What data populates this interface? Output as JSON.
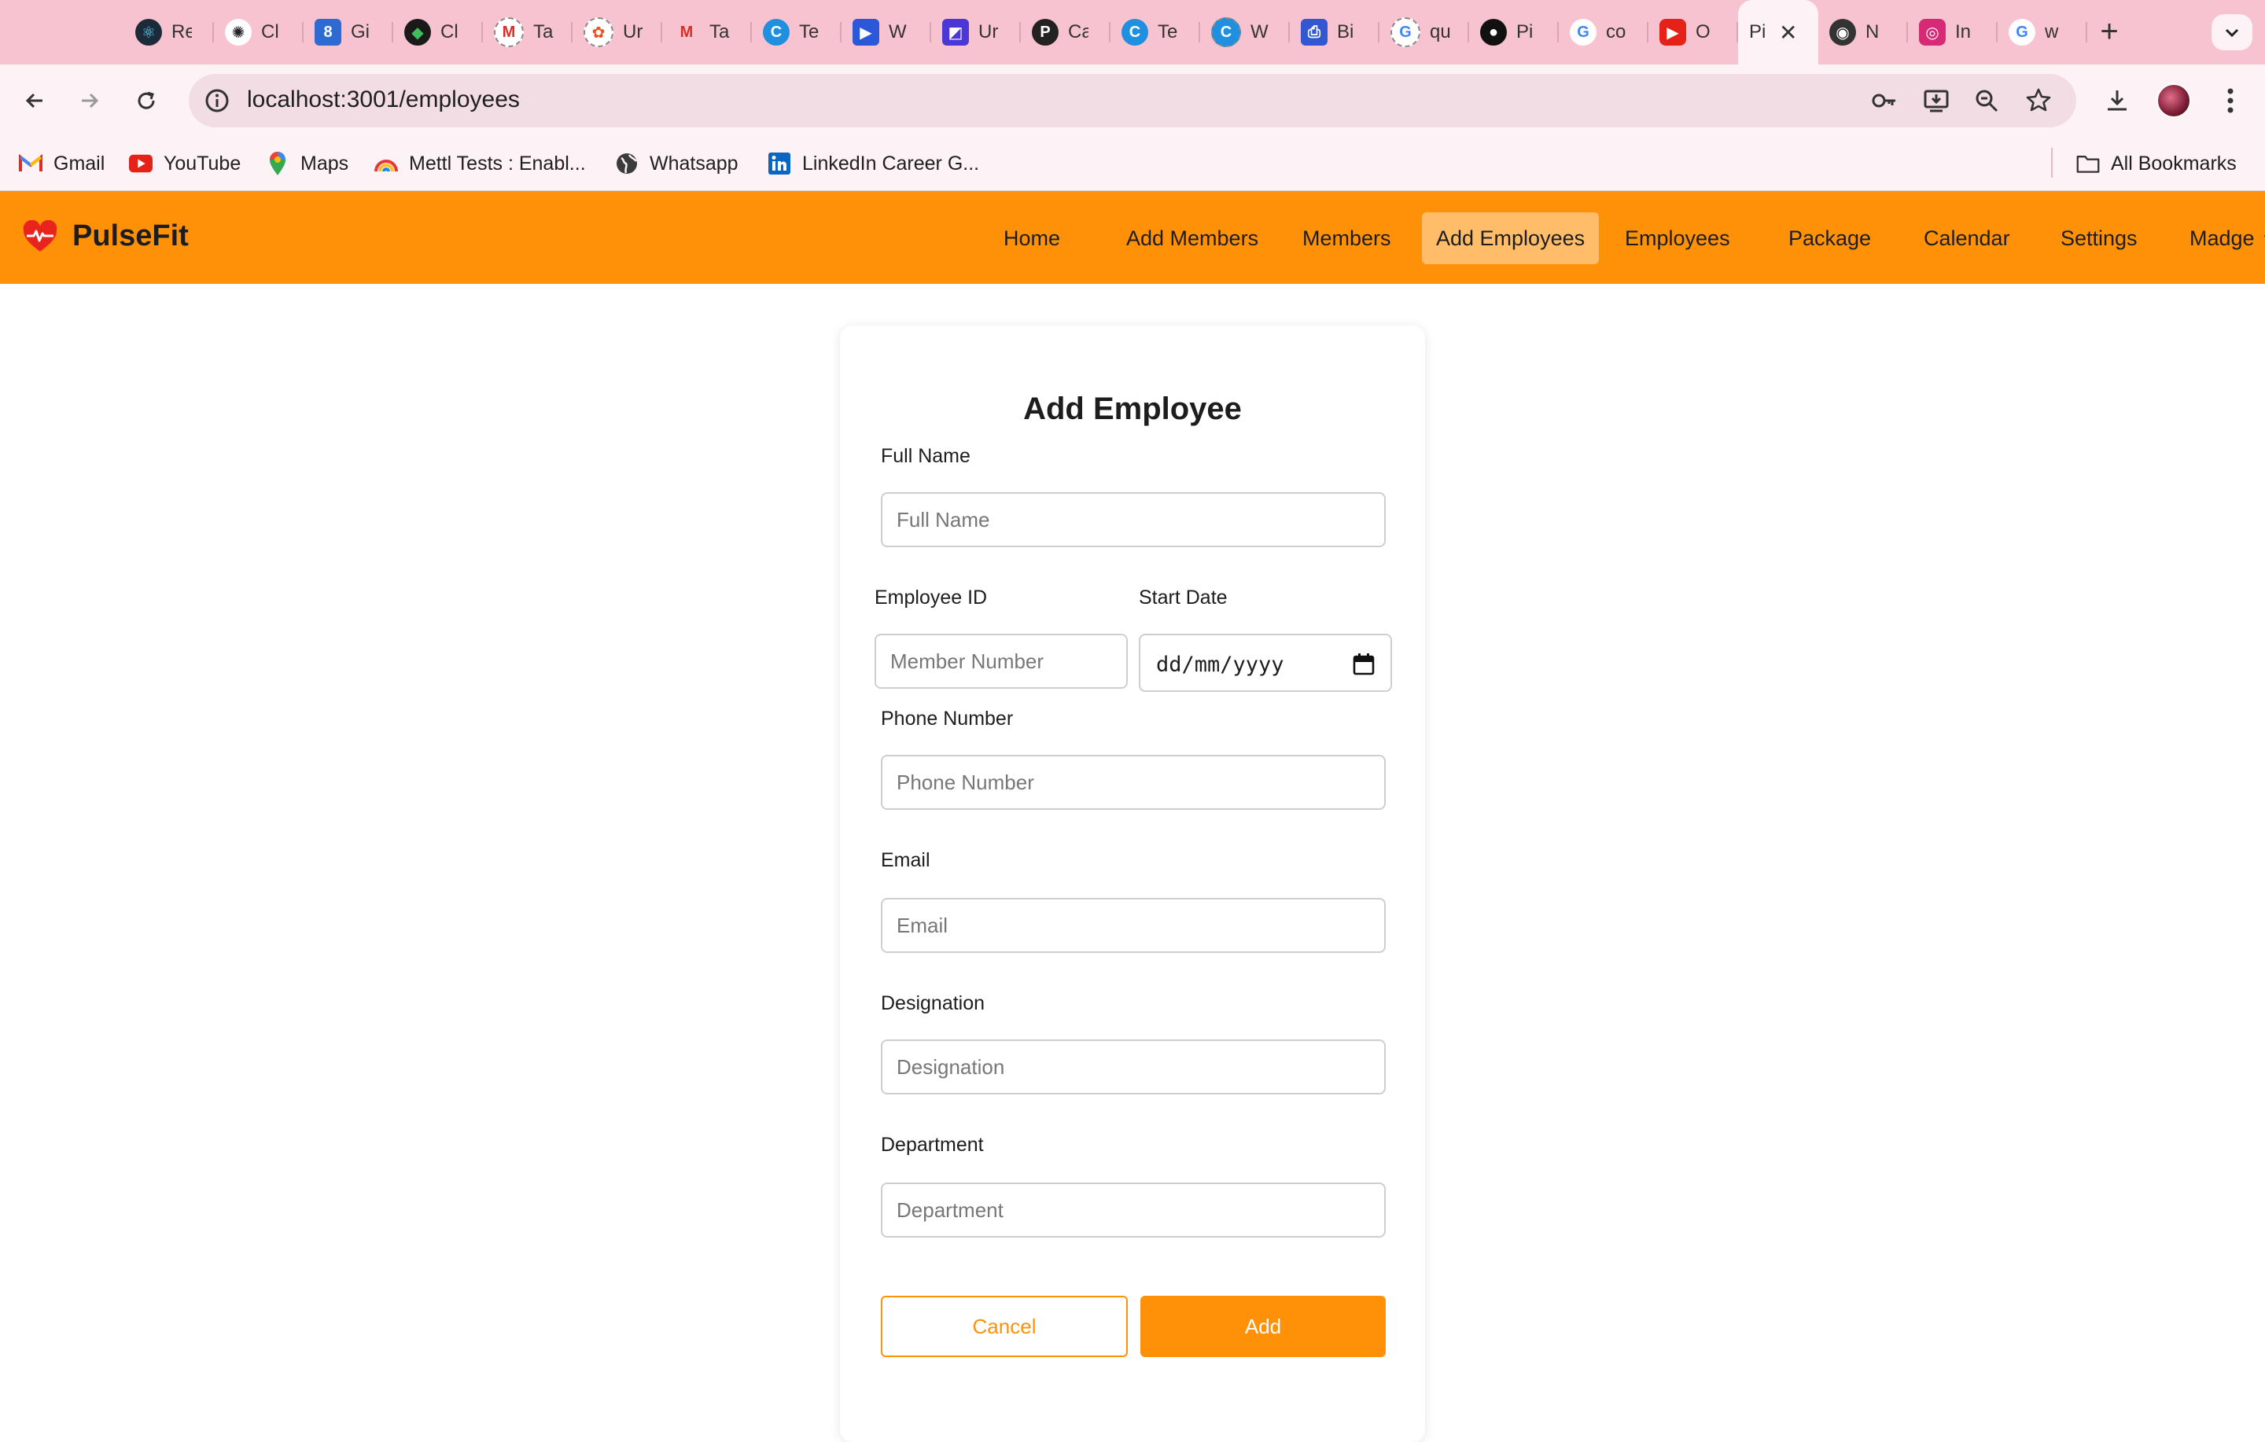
{
  "browser": {
    "tabs": [
      {
        "label": "Re",
        "icon": "react-icon",
        "color": "#1b2b3a"
      },
      {
        "label": "Cl",
        "icon": "chatgpt-icon",
        "color": "#ffffff"
      },
      {
        "label": "Gi",
        "icon": "calendar-icon",
        "color": "#2d6bd3"
      },
      {
        "label": "Cl",
        "icon": "mongodb-leaf-icon",
        "color": "#1a1a1a"
      },
      {
        "label": "Ta",
        "icon": "gmail-icon",
        "color": "#ffffff"
      },
      {
        "label": "Ur",
        "icon": "figma-icon",
        "color": "#ffffff"
      },
      {
        "label": "Ta",
        "icon": "gmail-icon",
        "color": "#ffffff"
      },
      {
        "label": "Te",
        "icon": "canva-icon",
        "color": "#1f8fe0"
      },
      {
        "label": "W",
        "icon": "video-icon",
        "color": "#2b58d9"
      },
      {
        "label": "Ur",
        "icon": "app-icon",
        "color": "#4a37d6"
      },
      {
        "label": "Ca",
        "icon": "chrome-profile-icon",
        "color": "#222222"
      },
      {
        "label": "Te",
        "icon": "canva-icon",
        "color": "#1f8fe0"
      },
      {
        "label": "W",
        "icon": "canva-icon",
        "color": "#1f8fe0"
      },
      {
        "label": "Bi",
        "icon": "printer-icon",
        "color": "#3357d1"
      },
      {
        "label": "qu",
        "icon": "google-icon",
        "color": "#ffffff"
      },
      {
        "label": "Pi",
        "icon": "github-icon",
        "color": "#111111"
      },
      {
        "label": "co",
        "icon": "google-icon",
        "color": "#ffffff"
      },
      {
        "label": "O",
        "icon": "youtube-icon",
        "color": "#e62117"
      },
      {
        "label": "Pi",
        "icon": "",
        "color": "#fdf2f5",
        "active": true
      },
      {
        "label": "N",
        "icon": "chrome-icon",
        "color": "#333333"
      },
      {
        "label": "In",
        "icon": "instagram-icon",
        "color": "#d62976"
      },
      {
        "label": "w",
        "icon": "google-icon",
        "color": "#ffffff"
      }
    ],
    "url": "localhost:3001/employees",
    "bookmarks": [
      {
        "label": "Gmail",
        "icon": "gmail-icon"
      },
      {
        "label": "YouTube",
        "icon": "youtube-icon"
      },
      {
        "label": "Maps",
        "icon": "maps-pin-icon"
      },
      {
        "label": "Mettl Tests : Enabl...",
        "icon": "mettl-icon"
      },
      {
        "label": "Whatsapp",
        "icon": "globe-icon"
      },
      {
        "label": "LinkedIn Career G...",
        "icon": "linkedin-icon"
      }
    ],
    "all_bookmarks": "All Bookmarks"
  },
  "app": {
    "brand": "PulseFit",
    "accent": "#ff9109",
    "nav": [
      {
        "label": "Home"
      },
      {
        "label": "Add Members"
      },
      {
        "label": "Members"
      },
      {
        "label": "Add Employees",
        "active": true
      },
      {
        "label": "Employees"
      },
      {
        "label": "Package"
      },
      {
        "label": "Calendar"
      },
      {
        "label": "Settings"
      },
      {
        "label": "Madge"
      }
    ]
  },
  "form": {
    "title": "Add Employee",
    "full_name": {
      "label": "Full Name",
      "placeholder": "Full Name"
    },
    "employee_id": {
      "label": "Employee ID",
      "placeholder": "Member Number"
    },
    "start_date": {
      "label": "Start Date",
      "placeholder": "dd/mm/yyyy"
    },
    "phone": {
      "label": "Phone Number",
      "placeholder": "Phone Number"
    },
    "email": {
      "label": "Email",
      "placeholder": "Email"
    },
    "designation": {
      "label": "Designation",
      "placeholder": "Designation"
    },
    "department": {
      "label": "Department",
      "placeholder": "Department"
    },
    "cancel_label": "Cancel",
    "add_label": "Add"
  }
}
